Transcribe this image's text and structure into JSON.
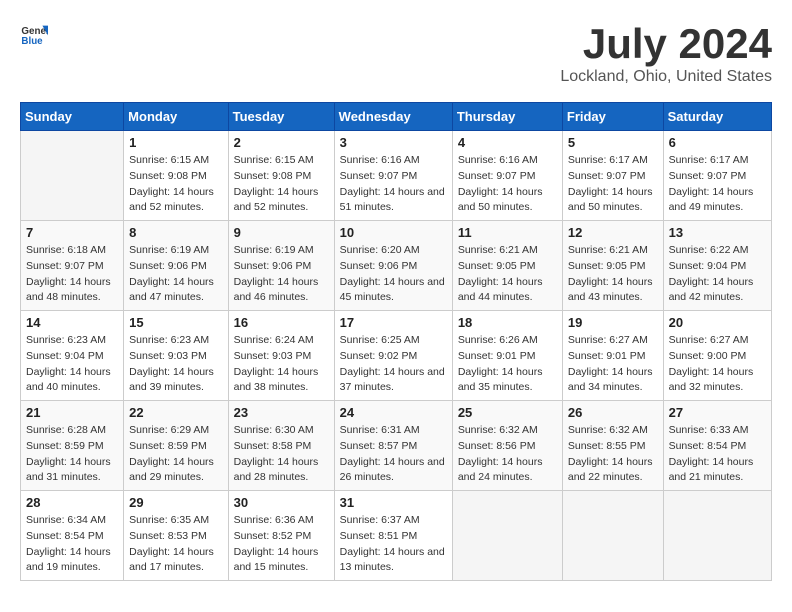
{
  "header": {
    "logo_general": "General",
    "logo_blue": "Blue",
    "title": "July 2024",
    "subtitle": "Lockland, Ohio, United States"
  },
  "columns": [
    "Sunday",
    "Monday",
    "Tuesday",
    "Wednesday",
    "Thursday",
    "Friday",
    "Saturday"
  ],
  "weeks": [
    [
      {
        "day": "",
        "sunrise": "",
        "sunset": "",
        "daylight": ""
      },
      {
        "day": "1",
        "sunrise": "Sunrise: 6:15 AM",
        "sunset": "Sunset: 9:08 PM",
        "daylight": "Daylight: 14 hours and 52 minutes."
      },
      {
        "day": "2",
        "sunrise": "Sunrise: 6:15 AM",
        "sunset": "Sunset: 9:08 PM",
        "daylight": "Daylight: 14 hours and 52 minutes."
      },
      {
        "day": "3",
        "sunrise": "Sunrise: 6:16 AM",
        "sunset": "Sunset: 9:07 PM",
        "daylight": "Daylight: 14 hours and 51 minutes."
      },
      {
        "day": "4",
        "sunrise": "Sunrise: 6:16 AM",
        "sunset": "Sunset: 9:07 PM",
        "daylight": "Daylight: 14 hours and 50 minutes."
      },
      {
        "day": "5",
        "sunrise": "Sunrise: 6:17 AM",
        "sunset": "Sunset: 9:07 PM",
        "daylight": "Daylight: 14 hours and 50 minutes."
      },
      {
        "day": "6",
        "sunrise": "Sunrise: 6:17 AM",
        "sunset": "Sunset: 9:07 PM",
        "daylight": "Daylight: 14 hours and 49 minutes."
      }
    ],
    [
      {
        "day": "7",
        "sunrise": "Sunrise: 6:18 AM",
        "sunset": "Sunset: 9:07 PM",
        "daylight": "Daylight: 14 hours and 48 minutes."
      },
      {
        "day": "8",
        "sunrise": "Sunrise: 6:19 AM",
        "sunset": "Sunset: 9:06 PM",
        "daylight": "Daylight: 14 hours and 47 minutes."
      },
      {
        "day": "9",
        "sunrise": "Sunrise: 6:19 AM",
        "sunset": "Sunset: 9:06 PM",
        "daylight": "Daylight: 14 hours and 46 minutes."
      },
      {
        "day": "10",
        "sunrise": "Sunrise: 6:20 AM",
        "sunset": "Sunset: 9:06 PM",
        "daylight": "Daylight: 14 hours and 45 minutes."
      },
      {
        "day": "11",
        "sunrise": "Sunrise: 6:21 AM",
        "sunset": "Sunset: 9:05 PM",
        "daylight": "Daylight: 14 hours and 44 minutes."
      },
      {
        "day": "12",
        "sunrise": "Sunrise: 6:21 AM",
        "sunset": "Sunset: 9:05 PM",
        "daylight": "Daylight: 14 hours and 43 minutes."
      },
      {
        "day": "13",
        "sunrise": "Sunrise: 6:22 AM",
        "sunset": "Sunset: 9:04 PM",
        "daylight": "Daylight: 14 hours and 42 minutes."
      }
    ],
    [
      {
        "day": "14",
        "sunrise": "Sunrise: 6:23 AM",
        "sunset": "Sunset: 9:04 PM",
        "daylight": "Daylight: 14 hours and 40 minutes."
      },
      {
        "day": "15",
        "sunrise": "Sunrise: 6:23 AM",
        "sunset": "Sunset: 9:03 PM",
        "daylight": "Daylight: 14 hours and 39 minutes."
      },
      {
        "day": "16",
        "sunrise": "Sunrise: 6:24 AM",
        "sunset": "Sunset: 9:03 PM",
        "daylight": "Daylight: 14 hours and 38 minutes."
      },
      {
        "day": "17",
        "sunrise": "Sunrise: 6:25 AM",
        "sunset": "Sunset: 9:02 PM",
        "daylight": "Daylight: 14 hours and 37 minutes."
      },
      {
        "day": "18",
        "sunrise": "Sunrise: 6:26 AM",
        "sunset": "Sunset: 9:01 PM",
        "daylight": "Daylight: 14 hours and 35 minutes."
      },
      {
        "day": "19",
        "sunrise": "Sunrise: 6:27 AM",
        "sunset": "Sunset: 9:01 PM",
        "daylight": "Daylight: 14 hours and 34 minutes."
      },
      {
        "day": "20",
        "sunrise": "Sunrise: 6:27 AM",
        "sunset": "Sunset: 9:00 PM",
        "daylight": "Daylight: 14 hours and 32 minutes."
      }
    ],
    [
      {
        "day": "21",
        "sunrise": "Sunrise: 6:28 AM",
        "sunset": "Sunset: 8:59 PM",
        "daylight": "Daylight: 14 hours and 31 minutes."
      },
      {
        "day": "22",
        "sunrise": "Sunrise: 6:29 AM",
        "sunset": "Sunset: 8:59 PM",
        "daylight": "Daylight: 14 hours and 29 minutes."
      },
      {
        "day": "23",
        "sunrise": "Sunrise: 6:30 AM",
        "sunset": "Sunset: 8:58 PM",
        "daylight": "Daylight: 14 hours and 28 minutes."
      },
      {
        "day": "24",
        "sunrise": "Sunrise: 6:31 AM",
        "sunset": "Sunset: 8:57 PM",
        "daylight": "Daylight: 14 hours and 26 minutes."
      },
      {
        "day": "25",
        "sunrise": "Sunrise: 6:32 AM",
        "sunset": "Sunset: 8:56 PM",
        "daylight": "Daylight: 14 hours and 24 minutes."
      },
      {
        "day": "26",
        "sunrise": "Sunrise: 6:32 AM",
        "sunset": "Sunset: 8:55 PM",
        "daylight": "Daylight: 14 hours and 22 minutes."
      },
      {
        "day": "27",
        "sunrise": "Sunrise: 6:33 AM",
        "sunset": "Sunset: 8:54 PM",
        "daylight": "Daylight: 14 hours and 21 minutes."
      }
    ],
    [
      {
        "day": "28",
        "sunrise": "Sunrise: 6:34 AM",
        "sunset": "Sunset: 8:54 PM",
        "daylight": "Daylight: 14 hours and 19 minutes."
      },
      {
        "day": "29",
        "sunrise": "Sunrise: 6:35 AM",
        "sunset": "Sunset: 8:53 PM",
        "daylight": "Daylight: 14 hours and 17 minutes."
      },
      {
        "day": "30",
        "sunrise": "Sunrise: 6:36 AM",
        "sunset": "Sunset: 8:52 PM",
        "daylight": "Daylight: 14 hours and 15 minutes."
      },
      {
        "day": "31",
        "sunrise": "Sunrise: 6:37 AM",
        "sunset": "Sunset: 8:51 PM",
        "daylight": "Daylight: 14 hours and 13 minutes."
      },
      {
        "day": "",
        "sunrise": "",
        "sunset": "",
        "daylight": ""
      },
      {
        "day": "",
        "sunrise": "",
        "sunset": "",
        "daylight": ""
      },
      {
        "day": "",
        "sunrise": "",
        "sunset": "",
        "daylight": ""
      }
    ]
  ]
}
